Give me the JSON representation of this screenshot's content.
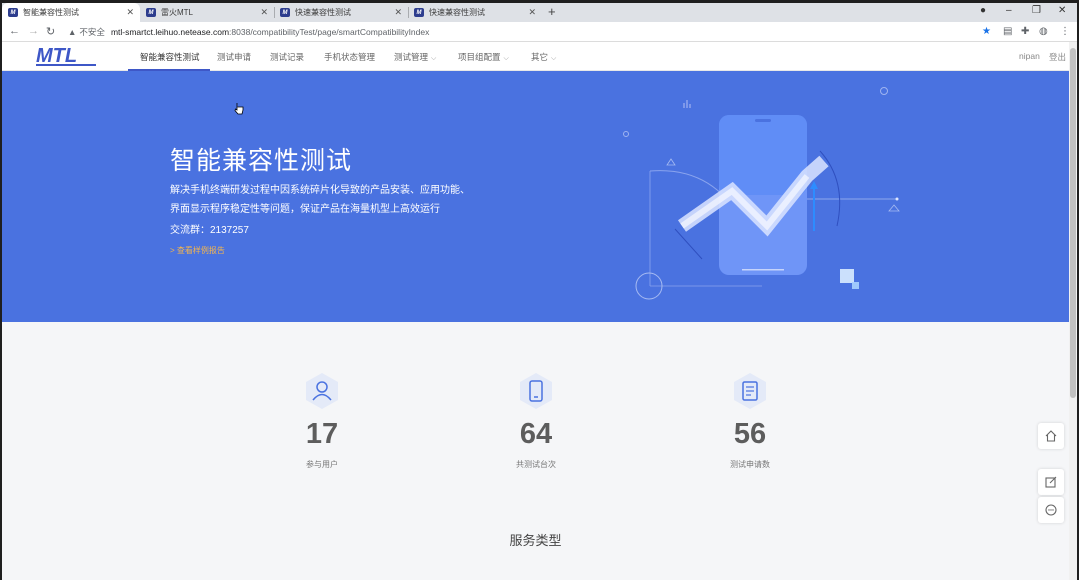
{
  "browser": {
    "tabs": [
      {
        "favicon": "M",
        "title": "智能兼容性测试",
        "active": true
      },
      {
        "favicon": "M",
        "title": "雷火MTL",
        "active": false
      },
      {
        "favicon": "M",
        "title": "快速兼容性测试",
        "active": false
      },
      {
        "favicon": "M",
        "title": "快速兼容性测试",
        "active": false
      }
    ],
    "new_tab_symbol": "+",
    "url_warning": "不安全",
    "url_host": "mtl-smartct.leihuo.netease.com",
    "url_rest": ":8038/compatibilityTest/page/smartCompatibilityIndex",
    "window_controls": [
      "–",
      "❐",
      "✕"
    ]
  },
  "nav": {
    "logo": "MTL",
    "items": [
      {
        "label": "智能兼容性测试",
        "dropdown": false
      },
      {
        "label": "测试申请",
        "dropdown": false
      },
      {
        "label": "测试记录",
        "dropdown": false
      },
      {
        "label": "手机状态管理",
        "dropdown": false
      },
      {
        "label": "测试管理",
        "dropdown": true
      },
      {
        "label": "项目组配置",
        "dropdown": true
      },
      {
        "label": "其它",
        "dropdown": true
      }
    ],
    "user": "nipan",
    "logout": "登出"
  },
  "hero": {
    "title": "智能兼容性测试",
    "desc_line1": "解决手机终端研发过程中因系统碎片化导致的产品安装、应用功能、",
    "desc_line2": "界面显示程序稳定性等问题，保证产品在海量机型上高效运行",
    "group": "交流群：2137257",
    "link": "> 查看样例报告"
  },
  "stats": [
    {
      "icon": "user-icon",
      "value": "17",
      "label": "参与用户"
    },
    {
      "icon": "phone-icon",
      "value": "64",
      "label": "共测试台次"
    },
    {
      "icon": "document-icon",
      "value": "56",
      "label": "测试申请数"
    }
  ],
  "services_title": "服务类型",
  "float_buttons": [
    "home-icon",
    "edit-icon",
    "message-icon"
  ],
  "colors": {
    "hero_bg": "#4a72e0",
    "brand": "#3e57c7",
    "link_orange": "#f5b64d"
  }
}
